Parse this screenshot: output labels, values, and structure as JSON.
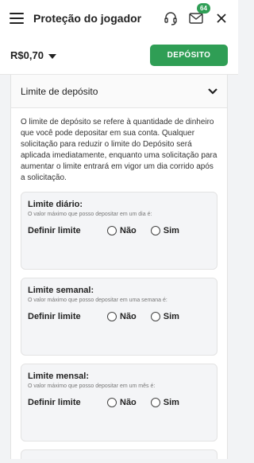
{
  "header": {
    "title": "Proteção do jogador",
    "notification_count": "64"
  },
  "balance": {
    "amount": "R$0,70"
  },
  "deposit_button": {
    "label": "DEPÓSITO"
  },
  "section": {
    "title": "Limite de depósito",
    "description": "O limite de depósito se refere à quantidade de dinheiro que você pode depositar em sua conta. Qualquer solicitação para reduzir o limite do Depósito será aplicada imediatamente, enquanto uma solicitação para aumentar o limite entrará em vigor um dia corrido após a solicitação."
  },
  "limits": [
    {
      "title": "Limite diário:",
      "subtitle": "O valor máximo que posso depositar em um dia é:",
      "define_label": "Definir limite",
      "option_no": "Não",
      "option_yes": "Sim"
    },
    {
      "title": "Limite semanal:",
      "subtitle": "O valor máximo que posso depositar em uma semana é:",
      "define_label": "Definir limite",
      "option_no": "Não",
      "option_yes": "Sim"
    },
    {
      "title": "Limite mensal:",
      "subtitle": "O valor máximo que posso depositar em um mês é:",
      "define_label": "Definir limite",
      "option_no": "Não",
      "option_yes": "Sim"
    }
  ],
  "colors": {
    "accent": "#2f9e55"
  },
  "icons": [
    "menu-icon",
    "headset-icon",
    "mail-icon",
    "close-icon",
    "chevron-down-icon"
  ]
}
